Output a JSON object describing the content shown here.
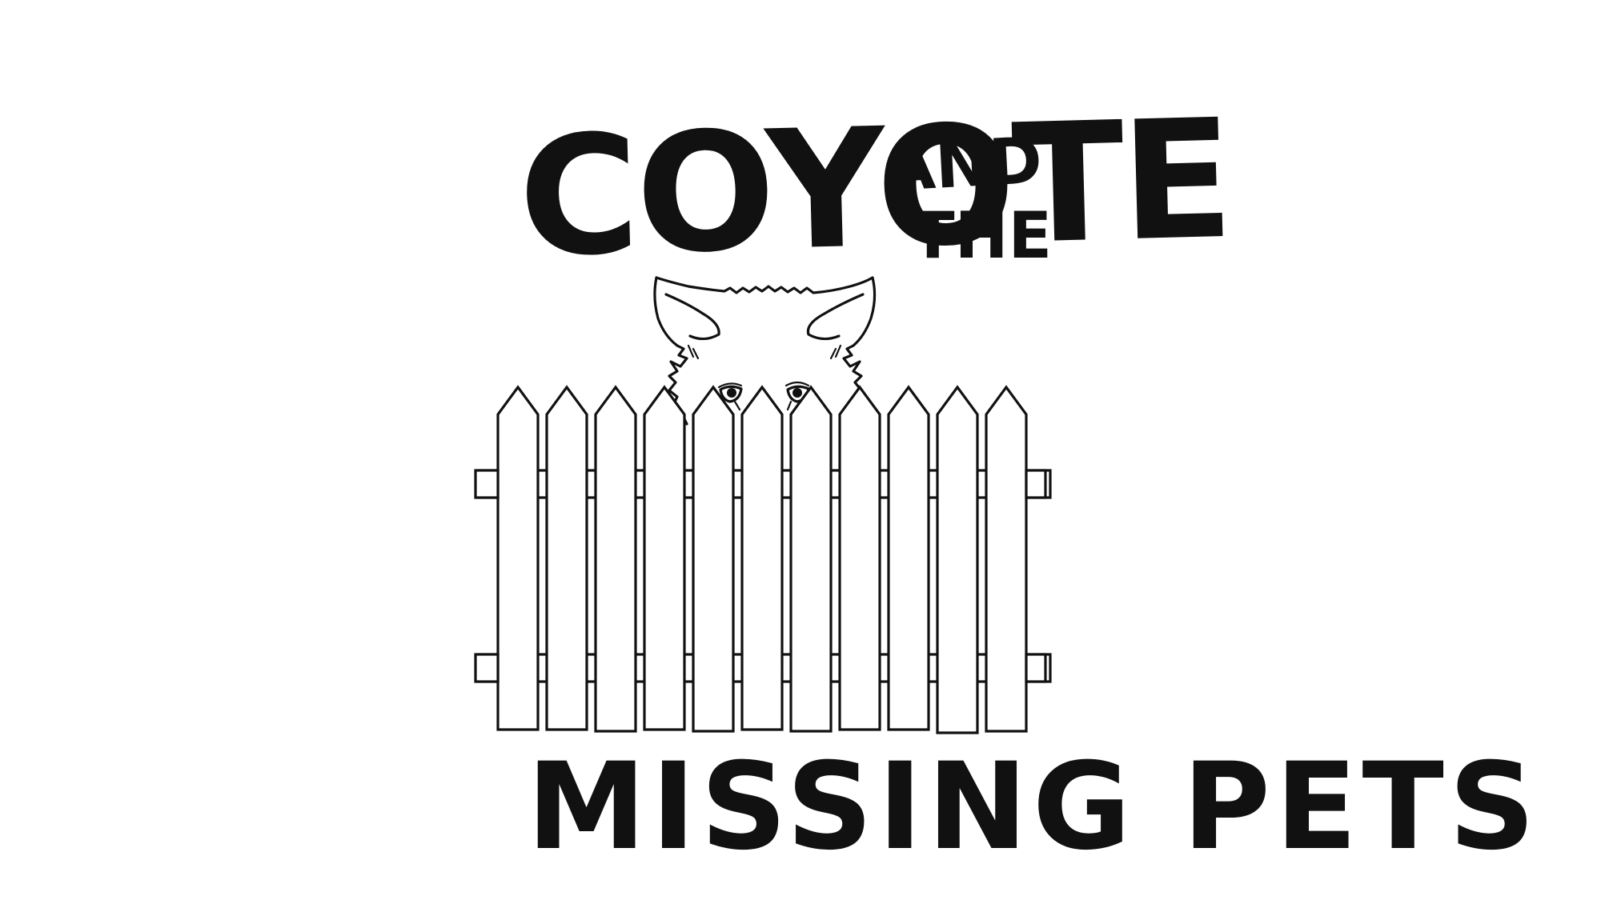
{
  "cover": {
    "title_main": "COYOTE",
    "title_and": "AND",
    "title_the": "THE",
    "title_bottom": "MISSING PETS"
  },
  "illustration": {
    "subject": "coyote-peeking-over-fence",
    "line_color": "#111111",
    "background_color": "#ffffff",
    "picket_count": 11
  }
}
